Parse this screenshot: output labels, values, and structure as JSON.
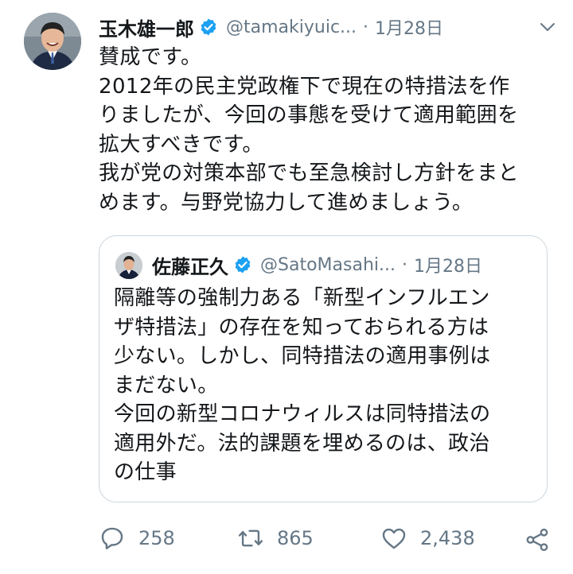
{
  "tweet": {
    "author_name": "玉木雄一郎",
    "handle": "@tamakiyuic...",
    "separator": "·",
    "date": "1月28日",
    "lines": [
      "賛成です。",
      "2012年の民主党政権下で現在の特措法を作",
      "りましたが、今回の事態を受けて適用範囲を",
      "拡大すべきです。",
      "我が党の対策本部でも至急検討し方針をまと",
      "めます。与野党協力して進めましょう。"
    ]
  },
  "quoted": {
    "author_name": "佐藤正久",
    "handle": "@SatoMasahi...",
    "separator": "·",
    "date": "1月28日",
    "lines": [
      "隔離等の強制力ある「新型インフルエン",
      "ザ特措法」の存在を知っておられる方は",
      "少ない。しかし、同特措法の適用事例は",
      "まだない。",
      "今回の新型コロナウィルスは同特措法の",
      "適用外だ。法的課題を埋めるのは、政治",
      "の仕事"
    ]
  },
  "actions": {
    "replies": "258",
    "retweets": "865",
    "likes": "2,438"
  },
  "icons": {
    "verified": "verified-badge-icon",
    "caret": "chevron-down-icon",
    "reply": "reply-icon",
    "retweet": "retweet-icon",
    "like": "heart-icon",
    "share": "share-icon"
  },
  "colors": {
    "verified": "#1da1f2",
    "muted": "#657786",
    "border": "#ccd6dd",
    "text": "#14171a"
  }
}
